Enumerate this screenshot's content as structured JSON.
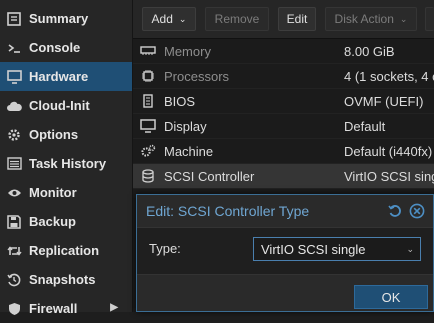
{
  "sidebar": {
    "items": [
      {
        "label": "Summary",
        "icon": "summary-icon"
      },
      {
        "label": "Console",
        "icon": "console-icon"
      },
      {
        "label": "Hardware",
        "icon": "monitor-icon",
        "active": true
      },
      {
        "label": "Cloud-Init",
        "icon": "cloud-icon"
      },
      {
        "label": "Options",
        "icon": "gear-icon"
      },
      {
        "label": "Task History",
        "icon": "list-icon"
      },
      {
        "label": "Monitor",
        "icon": "eye-icon"
      },
      {
        "label": "Backup",
        "icon": "floppy-icon"
      },
      {
        "label": "Replication",
        "icon": "retweet-icon"
      },
      {
        "label": "Snapshots",
        "icon": "history-icon"
      },
      {
        "label": "Firewall",
        "icon": "shield-icon",
        "submenu": true
      }
    ]
  },
  "toolbar": {
    "add_label": "Add",
    "remove_label": "Remove",
    "edit_label": "Edit",
    "disk_action_label": "Disk Action"
  },
  "hardware": {
    "rows": [
      {
        "name": "Memory",
        "value": "8.00 GiB",
        "icon": "memory-icon"
      },
      {
        "name": "Processors",
        "value": "4 (1 sockets, 4 c",
        "icon": "cpu-icon"
      },
      {
        "name": "BIOS",
        "value": "OVMF (UEFI)",
        "icon": "bios-icon"
      },
      {
        "name": "Display",
        "value": "Default",
        "icon": "display-icon"
      },
      {
        "name": "Machine",
        "value": "Default (i440fx)",
        "icon": "cogs-icon"
      },
      {
        "name": "SCSI Controller",
        "value": "VirtIO SCSI sing",
        "icon": "database-icon",
        "selected": true
      }
    ]
  },
  "dialog": {
    "title": "Edit: SCSI Controller Type",
    "field_label": "Type:",
    "selected_value": "VirtIO SCSI single",
    "ok_label": "OK"
  },
  "colors": {
    "accent": "#1f4f75",
    "dialog_title": "#6fa6d2",
    "background": "#1b1b1b"
  }
}
